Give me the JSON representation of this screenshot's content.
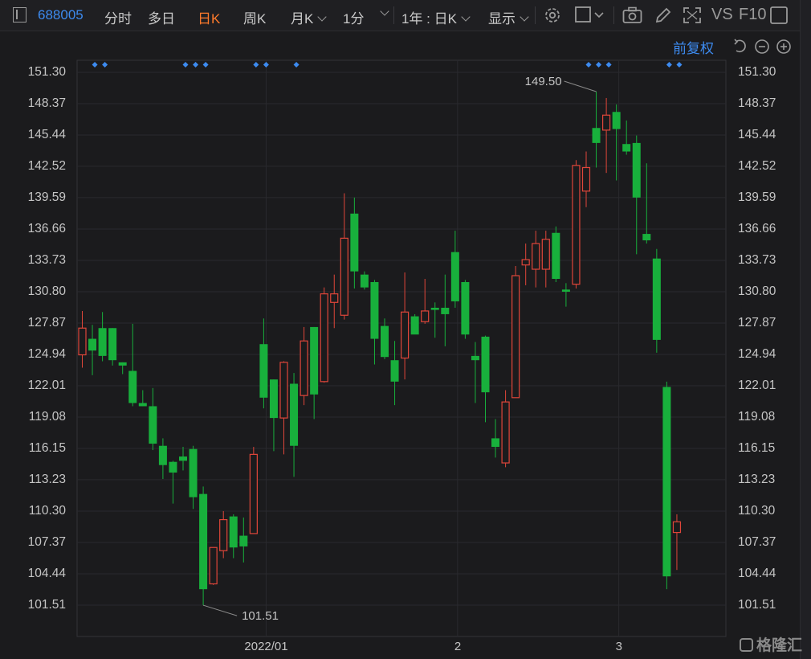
{
  "toolbar": {
    "code": "688005",
    "tabs": [
      "分时",
      "多日",
      "日K",
      "周K",
      "月K",
      "1分"
    ],
    "active_tab": "日K",
    "range": "1年 : 日K",
    "display": "显示",
    "vs": "VS",
    "f10": "F10"
  },
  "adjust_label": "前复权",
  "watermark": "格隆汇",
  "chart_data": {
    "type": "candlestick",
    "title": "",
    "ylim": [
      101.51,
      151.3
    ],
    "y_ticks": [
      "151.30",
      "148.37",
      "145.44",
      "142.52",
      "139.59",
      "136.66",
      "133.73",
      "130.80",
      "127.87",
      "124.94",
      "122.01",
      "119.08",
      "116.15",
      "113.23",
      "110.30",
      "107.37",
      "104.44",
      "101.51"
    ],
    "x_labels": [
      {
        "label": "2022/01",
        "index": 18
      },
      {
        "label": "2",
        "index": 37
      },
      {
        "label": "3",
        "index": 53
      }
    ],
    "annotations": [
      {
        "text": "149.50",
        "index": 51
      },
      {
        "text": "101.51",
        "index": 12
      }
    ],
    "markers": [
      1,
      2,
      10,
      11,
      12,
      17,
      18,
      21,
      50,
      51,
      52,
      58,
      59
    ],
    "candles": [
      {
        "o": 124.9,
        "h": 129.0,
        "l": 123.7,
        "c": 127.4
      },
      {
        "o": 126.4,
        "h": 127.7,
        "l": 123.0,
        "c": 125.3
      },
      {
        "o": 127.4,
        "h": 128.9,
        "l": 124.3,
        "c": 124.8
      },
      {
        "o": 127.4,
        "h": 127.4,
        "l": 123.9,
        "c": 124.4
      },
      {
        "o": 124.2,
        "h": 124.2,
        "l": 123.1,
        "c": 123.9
      },
      {
        "o": 123.4,
        "h": 127.8,
        "l": 120.1,
        "c": 120.4
      },
      {
        "o": 120.4,
        "h": 121.6,
        "l": 120.1,
        "c": 120.1
      },
      {
        "o": 120.1,
        "h": 121.8,
        "l": 116.0,
        "c": 116.6
      },
      {
        "o": 116.4,
        "h": 117.1,
        "l": 113.3,
        "c": 114.6
      },
      {
        "o": 114.9,
        "h": 115.0,
        "l": 111.0,
        "c": 113.9
      },
      {
        "o": 115.4,
        "h": 116.3,
        "l": 114.1,
        "c": 115.0
      },
      {
        "o": 116.1,
        "h": 116.4,
        "l": 110.5,
        "c": 111.6
      },
      {
        "o": 111.9,
        "h": 112.6,
        "l": 101.5,
        "c": 103.0
      },
      {
        "o": 103.5,
        "h": 106.9,
        "l": 103.4,
        "c": 106.9
      },
      {
        "o": 106.6,
        "h": 110.3,
        "l": 105.9,
        "c": 109.5
      },
      {
        "o": 109.8,
        "h": 110.0,
        "l": 105.9,
        "c": 106.9
      },
      {
        "o": 108.0,
        "h": 109.7,
        "l": 105.5,
        "c": 107.0
      },
      {
        "o": 108.2,
        "h": 116.3,
        "l": 108.2,
        "c": 115.6
      },
      {
        "o": 125.9,
        "h": 128.3,
        "l": 119.9,
        "c": 120.9
      },
      {
        "o": 122.6,
        "h": 122.6,
        "l": 115.9,
        "c": 119.0
      },
      {
        "o": 119.0,
        "h": 124.3,
        "l": 115.6,
        "c": 124.2
      },
      {
        "o": 122.2,
        "h": 123.2,
        "l": 113.5,
        "c": 116.4
      },
      {
        "o": 121.1,
        "h": 127.5,
        "l": 120.2,
        "c": 126.2
      },
      {
        "o": 127.5,
        "h": 127.5,
        "l": 118.9,
        "c": 121.2
      },
      {
        "o": 122.4,
        "h": 131.2,
        "l": 122.3,
        "c": 130.6
      },
      {
        "o": 129.8,
        "h": 132.4,
        "l": 127.4,
        "c": 130.6
      },
      {
        "o": 128.6,
        "h": 140.0,
        "l": 128.2,
        "c": 135.8
      },
      {
        "o": 138.1,
        "h": 139.6,
        "l": 131.1,
        "c": 132.7
      },
      {
        "o": 132.4,
        "h": 132.7,
        "l": 131.0,
        "c": 131.2
      },
      {
        "o": 131.7,
        "h": 131.9,
        "l": 124.0,
        "c": 126.4
      },
      {
        "o": 127.6,
        "h": 128.3,
        "l": 124.5,
        "c": 124.7
      },
      {
        "o": 124.4,
        "h": 126.2,
        "l": 120.2,
        "c": 122.4
      },
      {
        "o": 124.6,
        "h": 132.6,
        "l": 122.6,
        "c": 128.9
      },
      {
        "o": 128.5,
        "h": 128.7,
        "l": 126.9,
        "c": 126.8
      },
      {
        "o": 128.0,
        "h": 132.0,
        "l": 127.8,
        "c": 129.0
      },
      {
        "o": 129.3,
        "h": 129.8,
        "l": 126.5,
        "c": 129.1
      },
      {
        "o": 129.3,
        "h": 132.4,
        "l": 125.7,
        "c": 128.7
      },
      {
        "o": 134.5,
        "h": 136.5,
        "l": 129.3,
        "c": 129.9
      },
      {
        "o": 131.7,
        "h": 131.9,
        "l": 126.4,
        "c": 126.8
      },
      {
        "o": 124.8,
        "h": 126.1,
        "l": 120.4,
        "c": 124.4
      },
      {
        "o": 126.6,
        "h": 126.7,
        "l": 118.6,
        "c": 121.4
      },
      {
        "o": 117.1,
        "h": 118.9,
        "l": 115.3,
        "c": 116.3
      },
      {
        "o": 114.8,
        "h": 121.6,
        "l": 114.4,
        "c": 120.5
      },
      {
        "o": 120.9,
        "h": 133.2,
        "l": 120.9,
        "c": 132.3
      },
      {
        "o": 133.3,
        "h": 135.3,
        "l": 131.4,
        "c": 133.8
      },
      {
        "o": 132.9,
        "h": 136.5,
        "l": 131.2,
        "c": 135.3
      },
      {
        "o": 132.9,
        "h": 136.5,
        "l": 131.2,
        "c": 135.7
      },
      {
        "o": 136.3,
        "h": 136.9,
        "l": 131.7,
        "c": 132.0
      },
      {
        "o": 131.0,
        "h": 131.6,
        "l": 129.4,
        "c": 130.8
      },
      {
        "o": 131.5,
        "h": 143.1,
        "l": 131.1,
        "c": 142.6
      },
      {
        "o": 140.2,
        "h": 143.9,
        "l": 138.7,
        "c": 142.4
      },
      {
        "o": 146.1,
        "h": 149.5,
        "l": 142.4,
        "c": 144.7
      },
      {
        "o": 145.9,
        "h": 148.9,
        "l": 141.9,
        "c": 147.3
      },
      {
        "o": 147.6,
        "h": 148.3,
        "l": 141.2,
        "c": 146.0
      },
      {
        "o": 144.6,
        "h": 146.8,
        "l": 143.6,
        "c": 143.9
      },
      {
        "o": 144.7,
        "h": 145.4,
        "l": 134.3,
        "c": 139.6
      },
      {
        "o": 136.2,
        "h": 142.8,
        "l": 135.3,
        "c": 135.6
      },
      {
        "o": 133.9,
        "h": 134.8,
        "l": 125.1,
        "c": 126.3
      },
      {
        "o": 121.9,
        "h": 122.4,
        "l": 103.0,
        "c": 104.2
      },
      {
        "o": 108.3,
        "h": 110.0,
        "l": 104.8,
        "c": 109.3
      }
    ]
  }
}
